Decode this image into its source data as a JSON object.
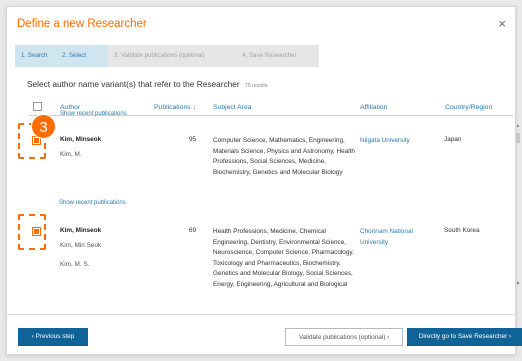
{
  "dialog": {
    "title": "Define a new Researcher",
    "close_symbol": "×"
  },
  "steps": [
    {
      "label": "1. Search",
      "state": "done"
    },
    {
      "label": "2. Select",
      "state": "done"
    },
    {
      "label": "3. Validate publications (optional)",
      "state": "todo"
    },
    {
      "label": "4. Save Researcher",
      "state": "todo"
    }
  ],
  "instruction": {
    "text": "Select author name variant(s) that refer to the Researcher",
    "results": "75 results"
  },
  "table": {
    "columns": {
      "author": "Author",
      "publications": "Publications ↓",
      "subject": "Subject Area",
      "affiliation": "Affiliation",
      "country": "Country/Region"
    },
    "show_recent_label": "Show recent publications",
    "rows": [
      {
        "name": "Kim, Minseok",
        "variants": [
          "Kim, M."
        ],
        "publications": "95",
        "subjects": "Computer Science, Mathematics, Engineering, Materials Science, Physics and Astronomy, Health Professions, Social Sciences, Medicine, Biochemistry, Genetics and Molecular Biology",
        "affiliation": "Niigata University",
        "country": "Japan",
        "checked": true
      },
      {
        "name": "Kim, Minseok",
        "variants": [
          "Kim, Min Seok",
          "Kim, M. S."
        ],
        "publications": "69",
        "subjects": "Health Professions, Medicine, Chemical Engineering, Dentistry, Environmental Science, Neuroscience, Computer Science, Pharmacology, Toxicology and Pharmaceutics, Biochemistry, Genetics and Molecular Biology, Social Sciences, Energy, Engineering, Agricultural and Biological",
        "affiliation": "Chonnam National University",
        "country": "South Korea",
        "checked": true
      }
    ]
  },
  "callout": {
    "number": "3"
  },
  "footer": {
    "prev_label": "‹ Previous step",
    "validate_label": "Validate publications (optional) ›",
    "save_label": "Directly go to Save Researcher ›"
  },
  "colors": {
    "accent": "#ff6c00",
    "primary": "#0f6396",
    "link": "#2a7ab0"
  }
}
